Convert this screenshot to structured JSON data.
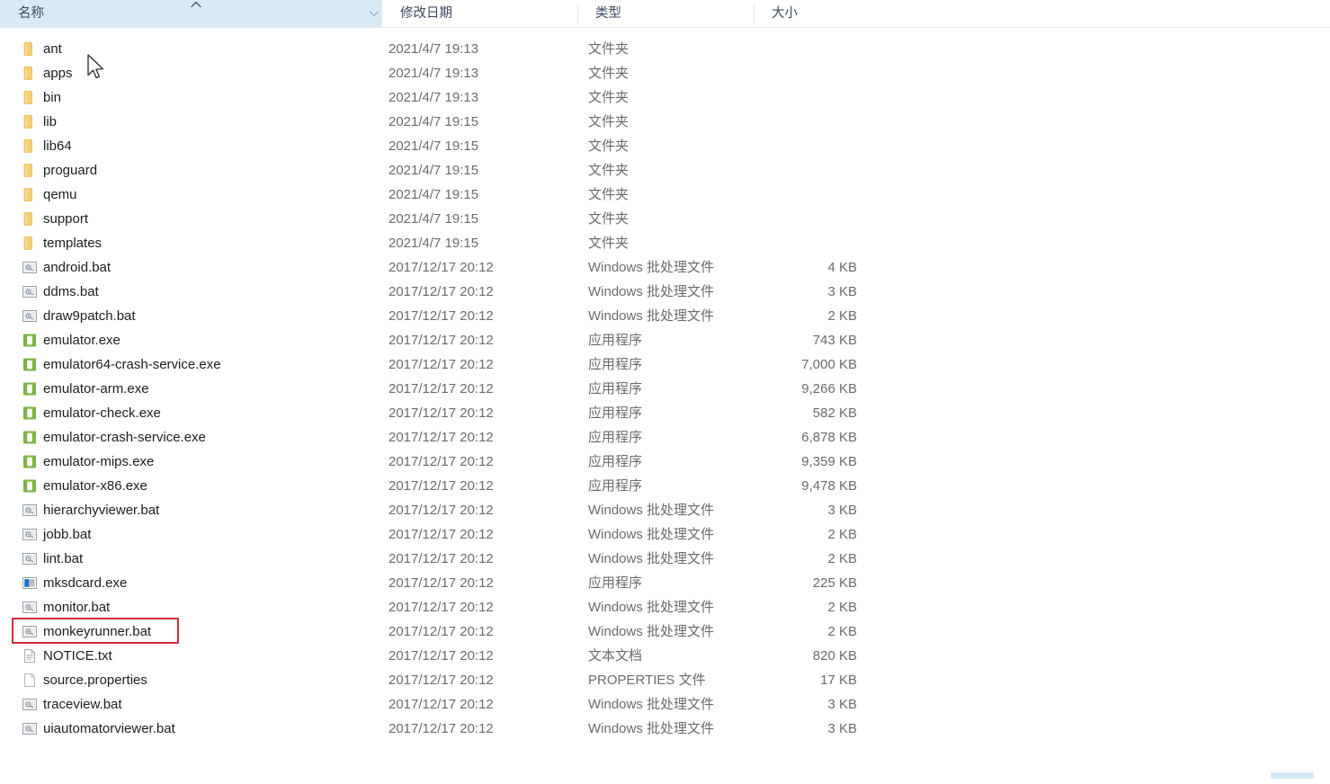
{
  "window": {
    "app": "File Explorer",
    "view": "details-list"
  },
  "columns": [
    {
      "key": "name",
      "label": "名称",
      "sorted": true,
      "sort_direction": "ascending",
      "has_filter_chevron": true
    },
    {
      "key": "date",
      "label": "修改日期",
      "sorted": false,
      "sort_direction": "",
      "has_filter_chevron": false
    },
    {
      "key": "type",
      "label": "类型",
      "sorted": false,
      "sort_direction": "",
      "has_filter_chevron": false
    },
    {
      "key": "size",
      "label": "大小",
      "sorted": false,
      "sort_direction": "",
      "has_filter_chevron": false
    }
  ],
  "colors": {
    "sorted_column_highlight": "#d9eaf7",
    "annotation_box": "#d02a3a",
    "folder_icon": "#f0c060",
    "exe_icon": "#7cb342",
    "name_text": "#1d1d1d",
    "meta_text": "#6b6b6b",
    "header_text": "#3b4a5e"
  },
  "annotation": {
    "type": "red-rectangle",
    "target_row_index": 24,
    "target_label": "monkeyrunner.bat"
  },
  "rows": [
    {
      "name": "ant",
      "date": "2021/4/7 19:13",
      "type": "文件夹",
      "size": "",
      "icon": "folder-icon"
    },
    {
      "name": "apps",
      "date": "2021/4/7 19:13",
      "type": "文件夹",
      "size": "",
      "icon": "folder-icon"
    },
    {
      "name": "bin",
      "date": "2021/4/7 19:13",
      "type": "文件夹",
      "size": "",
      "icon": "folder-icon"
    },
    {
      "name": "lib",
      "date": "2021/4/7 19:15",
      "type": "文件夹",
      "size": "",
      "icon": "folder-icon"
    },
    {
      "name": "lib64",
      "date": "2021/4/7 19:15",
      "type": "文件夹",
      "size": "",
      "icon": "folder-icon"
    },
    {
      "name": "proguard",
      "date": "2021/4/7 19:15",
      "type": "文件夹",
      "size": "",
      "icon": "folder-icon"
    },
    {
      "name": "qemu",
      "date": "2021/4/7 19:15",
      "type": "文件夹",
      "size": "",
      "icon": "folder-icon"
    },
    {
      "name": "support",
      "date": "2021/4/7 19:15",
      "type": "文件夹",
      "size": "",
      "icon": "folder-icon"
    },
    {
      "name": "templates",
      "date": "2021/4/7 19:15",
      "type": "文件夹",
      "size": "",
      "icon": "folder-icon"
    },
    {
      "name": "android.bat",
      "date": "2017/12/17 20:12",
      "type": "Windows 批处理文件",
      "size": "4 KB",
      "icon": "bat-icon"
    },
    {
      "name": "ddms.bat",
      "date": "2017/12/17 20:12",
      "type": "Windows 批处理文件",
      "size": "3 KB",
      "icon": "bat-icon"
    },
    {
      "name": "draw9patch.bat",
      "date": "2017/12/17 20:12",
      "type": "Windows 批处理文件",
      "size": "2 KB",
      "icon": "bat-icon"
    },
    {
      "name": "emulator.exe",
      "date": "2017/12/17 20:12",
      "type": "应用程序",
      "size": "743 KB",
      "icon": "android-exe-icon"
    },
    {
      "name": "emulator64-crash-service.exe",
      "date": "2017/12/17 20:12",
      "type": "应用程序",
      "size": "7,000 KB",
      "icon": "android-exe-icon"
    },
    {
      "name": "emulator-arm.exe",
      "date": "2017/12/17 20:12",
      "type": "应用程序",
      "size": "9,266 KB",
      "icon": "android-exe-icon"
    },
    {
      "name": "emulator-check.exe",
      "date": "2017/12/17 20:12",
      "type": "应用程序",
      "size": "582 KB",
      "icon": "android-exe-icon"
    },
    {
      "name": "emulator-crash-service.exe",
      "date": "2017/12/17 20:12",
      "type": "应用程序",
      "size": "6,878 KB",
      "icon": "android-exe-icon"
    },
    {
      "name": "emulator-mips.exe",
      "date": "2017/12/17 20:12",
      "type": "应用程序",
      "size": "9,359 KB",
      "icon": "android-exe-icon"
    },
    {
      "name": "emulator-x86.exe",
      "date": "2017/12/17 20:12",
      "type": "应用程序",
      "size": "9,478 KB",
      "icon": "android-exe-icon"
    },
    {
      "name": "hierarchyviewer.bat",
      "date": "2017/12/17 20:12",
      "type": "Windows 批处理文件",
      "size": "3 KB",
      "icon": "bat-icon"
    },
    {
      "name": "jobb.bat",
      "date": "2017/12/17 20:12",
      "type": "Windows 批处理文件",
      "size": "2 KB",
      "icon": "bat-icon"
    },
    {
      "name": "lint.bat",
      "date": "2017/12/17 20:12",
      "type": "Windows 批处理文件",
      "size": "2 KB",
      "icon": "bat-icon"
    },
    {
      "name": "mksdcard.exe",
      "date": "2017/12/17 20:12",
      "type": "应用程序",
      "size": "225 KB",
      "icon": "generic-exe-icon"
    },
    {
      "name": "monitor.bat",
      "date": "2017/12/17 20:12",
      "type": "Windows 批处理文件",
      "size": "2 KB",
      "icon": "bat-icon"
    },
    {
      "name": "monkeyrunner.bat",
      "date": "2017/12/17 20:12",
      "type": "Windows 批处理文件",
      "size": "2 KB",
      "icon": "bat-icon"
    },
    {
      "name": "NOTICE.txt",
      "date": "2017/12/17 20:12",
      "type": "文本文档",
      "size": "820 KB",
      "icon": "text-file-icon"
    },
    {
      "name": "source.properties",
      "date": "2017/12/17 20:12",
      "type": "PROPERTIES 文件",
      "size": "17 KB",
      "icon": "blank-file-icon"
    },
    {
      "name": "traceview.bat",
      "date": "2017/12/17 20:12",
      "type": "Windows 批处理文件",
      "size": "3 KB",
      "icon": "bat-icon"
    },
    {
      "name": "uiautomatorviewer.bat",
      "date": "2017/12/17 20:12",
      "type": "Windows 批处理文件",
      "size": "3 KB",
      "icon": "bat-icon"
    }
  ]
}
